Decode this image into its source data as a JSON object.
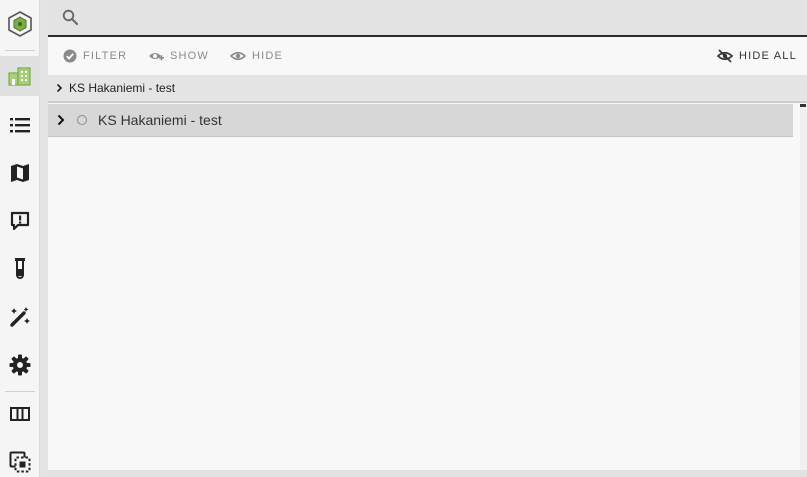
{
  "sidebar": {
    "logo_icon": "hexagon-logo-icon",
    "items": [
      {
        "name": "buildings",
        "icon": "building-icon",
        "active": true
      },
      {
        "name": "list",
        "icon": "list-icon"
      },
      {
        "name": "map",
        "icon": "map-icon"
      },
      {
        "name": "feedback",
        "icon": "comment-alert-icon"
      },
      {
        "name": "test",
        "icon": "test-tube-icon"
      },
      {
        "name": "tools",
        "icon": "magic-wand-icon"
      },
      {
        "name": "settings",
        "icon": "gear-icon"
      },
      {
        "name": "columns",
        "icon": "columns-icon"
      },
      {
        "name": "selection",
        "icon": "select-icon"
      }
    ],
    "accent_color": "#7cab4a"
  },
  "search": {
    "placeholder": "",
    "value": ""
  },
  "toolbar": {
    "filter_label": "FILTER",
    "show_label": "SHOW",
    "hide_label": "HIDE",
    "hide_all_label": "HIDE ALL"
  },
  "breadcrumb": {
    "label": "KS Hakaniemi - test"
  },
  "tree": {
    "rows": [
      {
        "label": "KS Hakaniemi - test",
        "expanded": false,
        "selected": false
      }
    ]
  }
}
